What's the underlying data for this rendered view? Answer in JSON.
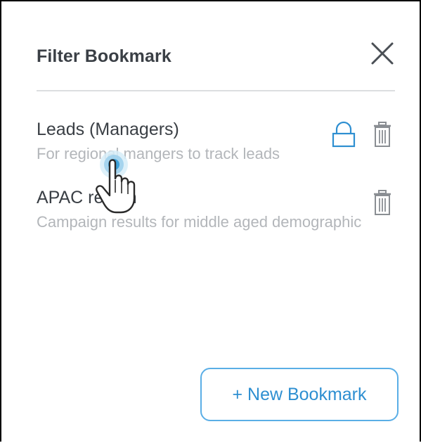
{
  "panel": {
    "title": "Filter Bookmark",
    "close_icon": "close-icon"
  },
  "bookmarks": [
    {
      "name": "Leads (Managers)",
      "description": "For regional mangers to track leads",
      "locked": true,
      "icons": [
        "lock-icon",
        "trash-icon"
      ]
    },
    {
      "name": "APAC region",
      "description": "Campaign results for middle aged demographic",
      "locked": false,
      "icons": [
        "trash-icon"
      ]
    }
  ],
  "actions": {
    "new_bookmark_label": "+ New Bookmark"
  },
  "colors": {
    "accent": "#2e8fd1",
    "accent_border": "#5aaee6",
    "title_text": "#3a3f45",
    "muted_text": "#b3b6ba",
    "divider": "#dcdee0",
    "icon_gray": "#8a8e93"
  }
}
